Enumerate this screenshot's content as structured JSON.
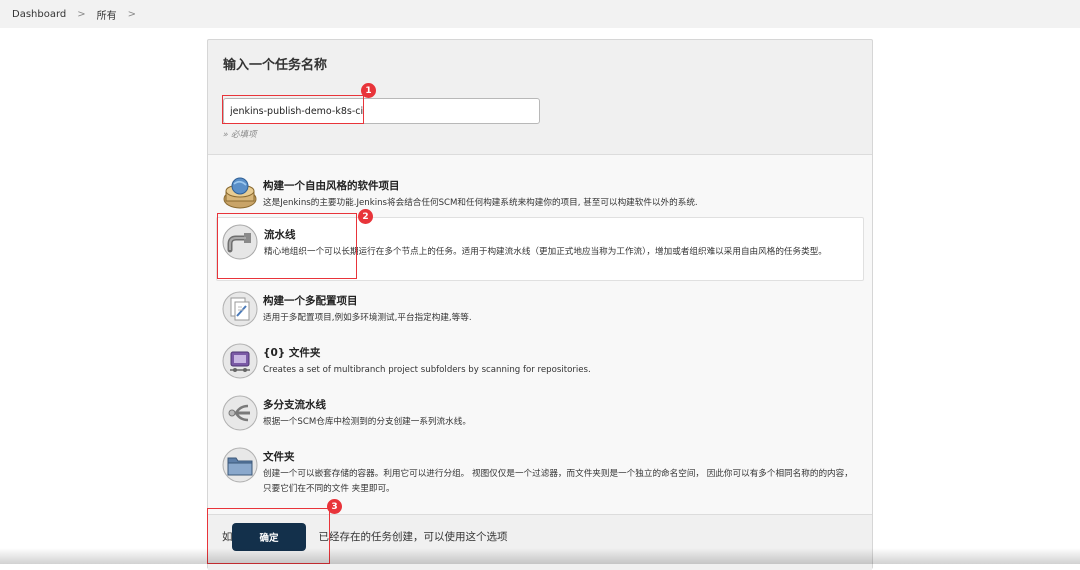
{
  "breadcrumb": {
    "items": [
      "Dashboard",
      "所有"
    ],
    "separator": ">"
  },
  "form": {
    "title": "输入一个任务名称",
    "item_name_value": "jenkins-publish-demo-k8s-ci",
    "required_note": "» 必填项"
  },
  "item_types": [
    {
      "title": "构建一个自由风格的软件项目",
      "description": "这是Jenkins的主要功能.Jenkins将会结合任何SCM和任何构建系统来构建你的项目, 甚至可以构建软件以外的系统.",
      "icon": "freestyle-project-icon",
      "selected": false
    },
    {
      "title": "流水线",
      "description": "精心地组织一个可以长期运行在多个节点上的任务。适用于构建流水线（更加正式地应当称为工作流），增加或者组织难以采用自由风格的任务类型。",
      "icon": "pipeline-icon",
      "selected": true
    },
    {
      "title": "构建一个多配置项目",
      "description": "适用于多配置项目,例如多环境测试,平台指定构建,等等.",
      "icon": "multi-config-project-icon",
      "selected": false
    },
    {
      "title": "{0} 文件夹",
      "description": "Creates a set of multibranch project subfolders by scanning for repositories.",
      "icon": "organization-folder-icon",
      "selected": false
    },
    {
      "title": "多分支流水线",
      "description": "根据一个SCM仓库中检测到的分支创建一系列流水线。",
      "icon": "multibranch-pipeline-icon",
      "selected": false
    },
    {
      "title": "文件夹",
      "description": "创建一个可以嵌套存储的容器。利用它可以进行分组。 视图仅仅是一个过滤器，而文件夹则是一个独立的命名空间， 因此你可以有多个相同名称的的内容，只要它们在不同的文件 夹里即可。",
      "icon": "folder-icon",
      "selected": false
    }
  ],
  "copy_from": {
    "text_prefix": "如",
    "text": "已经存在的任务创建，可以使用这个选项"
  },
  "ok_button_label": "确定",
  "annotations": [
    "1",
    "2",
    "3"
  ],
  "colors": {
    "callout": "#e8343a",
    "ok_button_bg": "#13304b",
    "breadcrumb_bg": "#f2f2f2"
  }
}
